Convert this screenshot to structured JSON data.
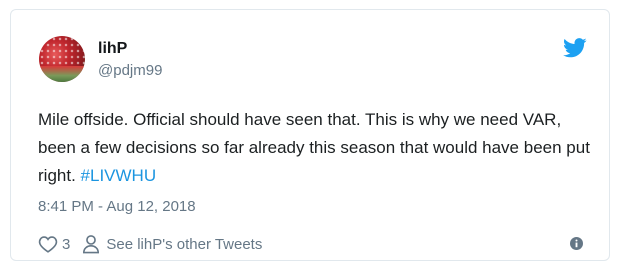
{
  "author": {
    "name": "lihP",
    "handle": "@pdjm99"
  },
  "tweet": {
    "text_before": "Mile offside. Official should have seen that. This is why we need VAR, been a few decisions so far already this season that would have been put right. ",
    "hashtag": "#LIVWHU",
    "timestamp": "8:41 PM - Aug 12, 2018"
  },
  "actions": {
    "like_count": "3",
    "others_label": "See lihP's other Tweets"
  },
  "icons": {
    "brand": "twitter-bird-icon",
    "like": "heart-icon",
    "others": "person-icon",
    "info": "info-icon"
  },
  "colors": {
    "brand": "#1da1f2",
    "link": "#1b95e0",
    "muted": "#657786",
    "text": "#1c2022"
  }
}
